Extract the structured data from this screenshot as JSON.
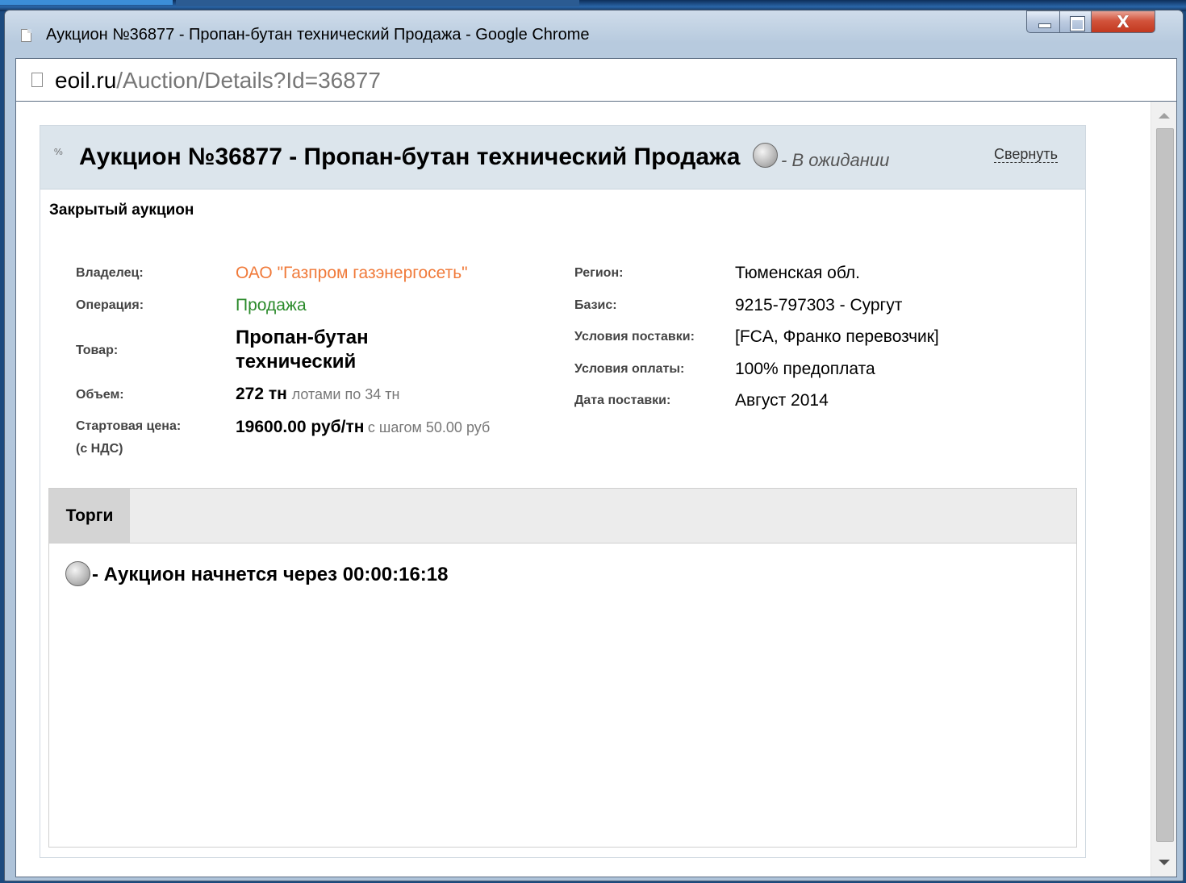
{
  "window": {
    "title": "Аукцион №36877 - Пропан-бутан технический Продажа - Google Chrome",
    "controls": {
      "minimize": "minimize-icon",
      "maximize": "maximize-icon",
      "close_glyph": "X"
    }
  },
  "address_bar": {
    "host": "eoil.ru",
    "path": "/Auction/Details?Id=36877",
    "icon": "page-icon"
  },
  "auction": {
    "header_icon_glyph": "⁰⁄₀",
    "title": "Аукцион №36877 - Пропан-бутан технический Продажа",
    "status": "- В ожидании",
    "collapse_label": "Свернуть",
    "type": "Закрытый аукцион",
    "details_left": {
      "owner": {
        "label": "Владелец:",
        "value": "ОАО \"Газпром газэнергосеть\""
      },
      "operation": {
        "label": "Операция:",
        "value": "Продажа"
      },
      "product": {
        "label": "Товар:",
        "value": "Пропан-бутан технический"
      },
      "volume": {
        "label": "Объем:",
        "amount": "272 тн",
        "lots": "лотами по 34 тн"
      },
      "start_price": {
        "label_line1": "Стартовая цена:",
        "label_line2": "(с НДС)",
        "price": "19600.00 руб/тн",
        "step": "с шагом 50.00 руб"
      }
    },
    "details_right": {
      "region": {
        "label": "Регион:",
        "value": "Тюменская обл."
      },
      "basis": {
        "label": "Базис:",
        "value": "9215-797303 - Сургут"
      },
      "delivery_terms": {
        "label": "Условия поставки:",
        "value": "[FCA, Франко перевозчик]"
      },
      "payment_terms": {
        "label": "Условия оплаты:",
        "value": "100% предоплата"
      },
      "delivery_date": {
        "label": "Дата поставки:",
        "value": "Август 2014"
      }
    },
    "tabs": [
      {
        "label": "Торги",
        "active": true
      }
    ],
    "countdown": "- Аукцион начнется через 00:00:16:18"
  },
  "colors": {
    "owner_link": "#f07a3a",
    "operation": "#2a8a2a",
    "header_bg": "#dce5ec",
    "close_button": "#c2381f"
  }
}
